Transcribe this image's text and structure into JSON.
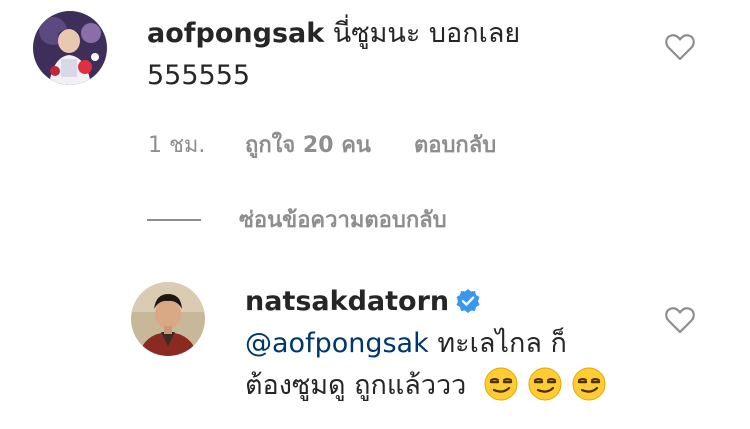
{
  "comment1": {
    "username": "aofpongsak",
    "text_line1": "นี่ซูมนะ บอกเลย",
    "text_line2": "555555",
    "time": "1 ชม.",
    "likes": "ถูกใจ 20 คน",
    "reply_label": "ตอบกลับ",
    "like_icon": "heart-outline-icon"
  },
  "hide_replies": {
    "label": "ซ่อนข้อความตอบกลับ"
  },
  "reply1": {
    "username": "natsakdatorn",
    "verified_icon": "verified-badge-icon",
    "mention": "@aofpongsak",
    "text_line1": "ทะเลไกล ก็",
    "text_line2": "ต้องซูมดู ถูกแล้ววว",
    "emoji_icon": "smirking-face-emoji",
    "like_icon": "heart-outline-icon"
  },
  "colors": {
    "primary_text": "#262626",
    "secondary_text": "#8e8e8e",
    "mention": "#00376b",
    "verified_blue": "#3897f0"
  }
}
